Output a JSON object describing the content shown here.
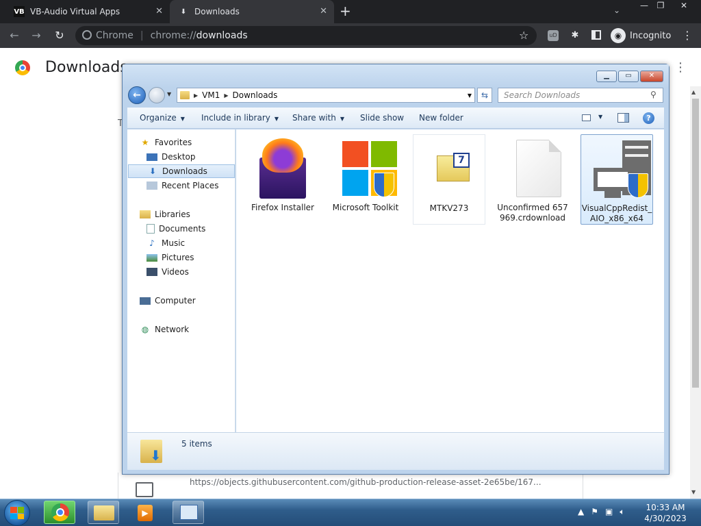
{
  "browser": {
    "tabs": [
      {
        "favicon_text": "VB",
        "title": "VB-Audio Virtual Apps",
        "active": false
      },
      {
        "favicon_text": "⬇",
        "title": "Downloads",
        "active": true
      }
    ],
    "omnibox": {
      "site_label": "Chrome",
      "url_prefix": "chrome://",
      "url_path": "downloads"
    },
    "profile_label": "Incognito"
  },
  "downloads_page": {
    "title": "Downloads",
    "partial_letter": "T",
    "card_url": "https://objects.githubusercontent.com/github-production-release-asset-2e65be/167..."
  },
  "explorer": {
    "breadcrumb": [
      "VM1",
      "Downloads"
    ],
    "search_placeholder": "Search Downloads",
    "commands": {
      "organize": "Organize",
      "include": "Include in library",
      "share": "Share with",
      "slideshow": "Slide show",
      "newfolder": "New folder"
    },
    "nav": {
      "favorites": "Favorites",
      "desktop": "Desktop",
      "downloads": "Downloads",
      "recent": "Recent Places",
      "libraries": "Libraries",
      "documents": "Documents",
      "music": "Music",
      "pictures": "Pictures",
      "videos": "Videos",
      "computer": "Computer",
      "network": "Network"
    },
    "files": [
      {
        "name": "Firefox Installer",
        "icon": "firefox-icon"
      },
      {
        "name": "Microsoft Toolkit",
        "icon": "ms-shield-icon"
      },
      {
        "name": "MTKV273",
        "icon": "7zip-icon"
      },
      {
        "name": "Unconfirmed 657969.crdownload",
        "icon": "blank-file-icon"
      },
      {
        "name": "VisualCppRedist_AIO_x86_x64",
        "icon": "installer-icon"
      }
    ],
    "status": "5 items"
  },
  "taskbar": {
    "time": "10:33 AM",
    "date": "4/30/2023"
  }
}
